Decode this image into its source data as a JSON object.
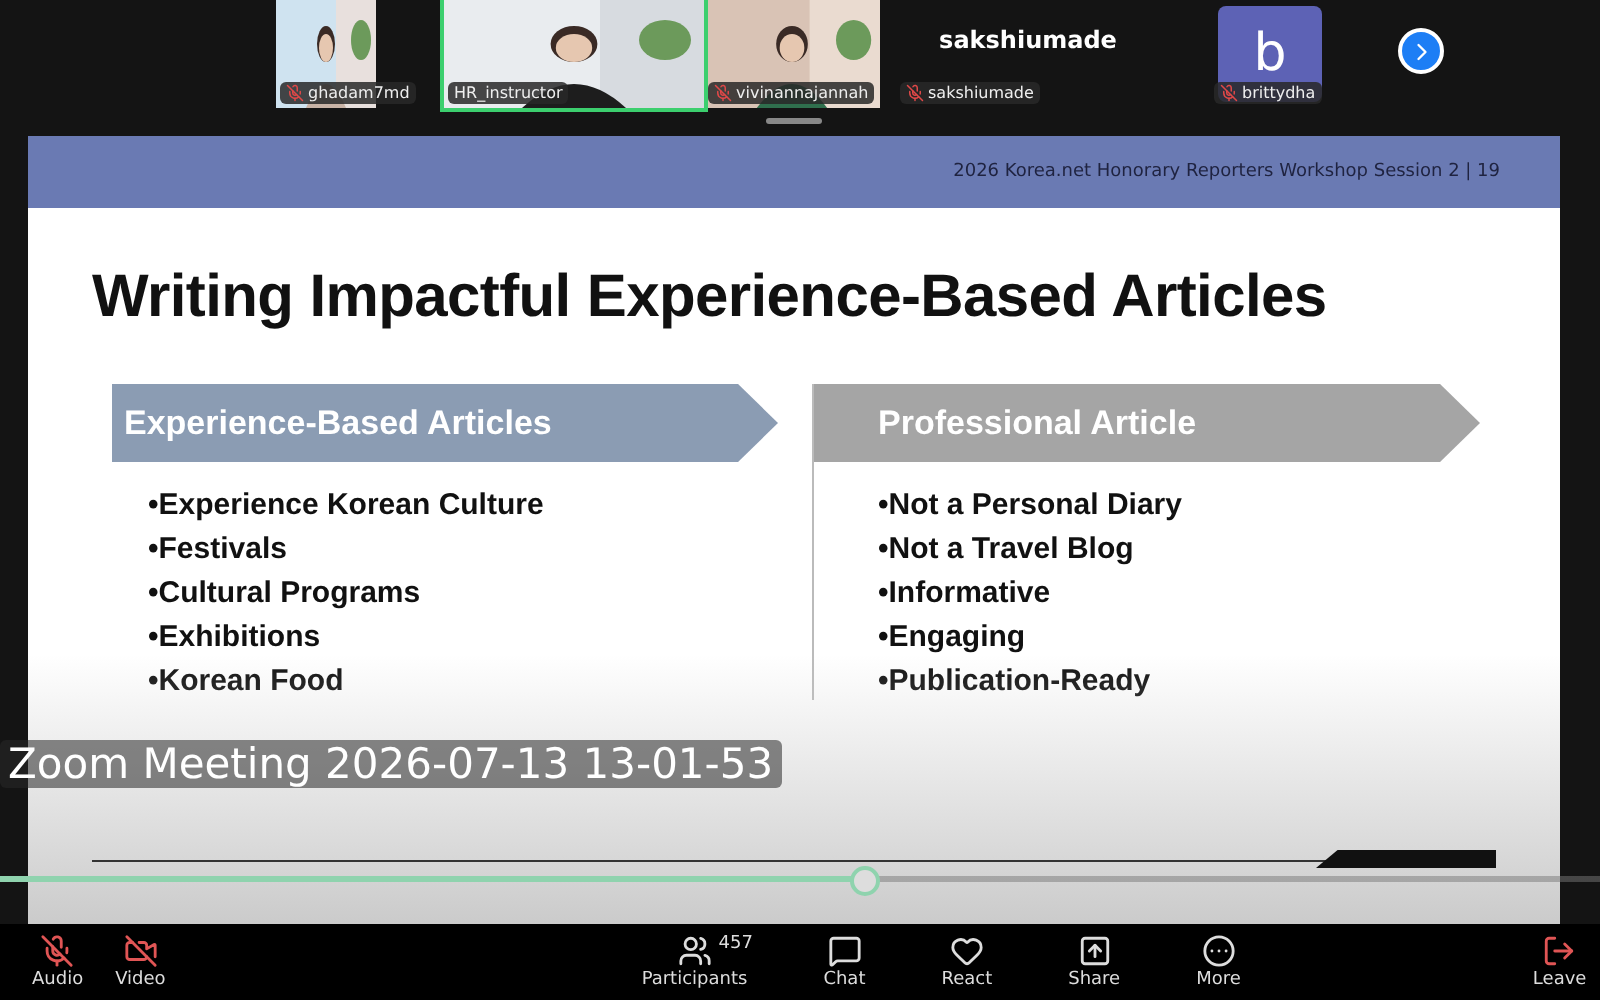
{
  "participants": [
    {
      "name": "ghadam7md",
      "kind": "video",
      "muted": true,
      "speaking": false
    },
    {
      "name": "HR_instructor",
      "kind": "video",
      "muted": false,
      "speaking": true
    },
    {
      "name": "vivinannajannah",
      "kind": "video",
      "muted": true,
      "speaking": false
    },
    {
      "name": "sakshiumade",
      "kind": "name",
      "display_name": "sakshiumade",
      "muted": true,
      "speaking": false
    },
    {
      "name": "brittydha",
      "kind": "avatar",
      "initial": "b",
      "muted": true,
      "speaking": false
    }
  ],
  "slide": {
    "header": "2026 Korea.net Honorary Reporters Workshop Session 2 | 19",
    "title": "Writing Impactful Experience-Based Articles",
    "columns": [
      {
        "heading": "Experience-Based Articles",
        "color": "#8b9cb3",
        "items": [
          "•Experience Korean Culture",
          "•Festivals",
          "•Cultural Programs",
          "•Exhibitions",
          "•Korean Food"
        ]
      },
      {
        "heading": "Professional Article",
        "color": "#a5a5a5",
        "items": [
          "•Not a Personal Diary",
          "•Not a Travel Blog",
          "•Informative",
          "•Engaging",
          "•Publication-Ready"
        ]
      }
    ]
  },
  "player": {
    "title": "Zoom Meeting 2026-07-13 13-01-53",
    "level": 0.54
  },
  "toolbar": [
    {
      "kind": "audio",
      "label": "Audio",
      "off": true
    },
    {
      "kind": "video",
      "label": "Video",
      "off": true
    },
    {
      "kind": "participants",
      "label": "Participants",
      "count": "457"
    },
    {
      "kind": "chat",
      "label": "Chat"
    },
    {
      "kind": "react",
      "label": "React"
    },
    {
      "kind": "share",
      "label": "Share"
    },
    {
      "kind": "more",
      "label": "More"
    },
    {
      "kind": "leave",
      "label": "Leave"
    }
  ]
}
